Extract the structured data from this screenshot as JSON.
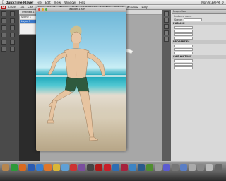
{
  "menubar": {
    "app": "QuickTime Player",
    "items": [
      "File",
      "Edit",
      "View",
      "Window",
      "Help"
    ],
    "right": [
      "Mon 9:39 PM"
    ]
  },
  "flashbar": {
    "brand": "Fl",
    "app": "Flash",
    "items": [
      "File",
      "Edit",
      "View",
      "Insert",
      "Modify",
      "Text",
      "Commands",
      "Control",
      "Debug",
      "Window",
      "Help"
    ]
  },
  "doc_tab": "Untitled-1",
  "library": {
    "rows": [
      "Scene 1",
      "Layer 1"
    ]
  },
  "quicktime": {
    "filename": "fashion-1.swf"
  },
  "properties": {
    "header": "Properties",
    "rows": [
      "Instance name",
      "Scene",
      "Document"
    ],
    "sections": [
      "PUBLISH",
      "PROPERTIES",
      "SWF HISTORY"
    ]
  }
}
